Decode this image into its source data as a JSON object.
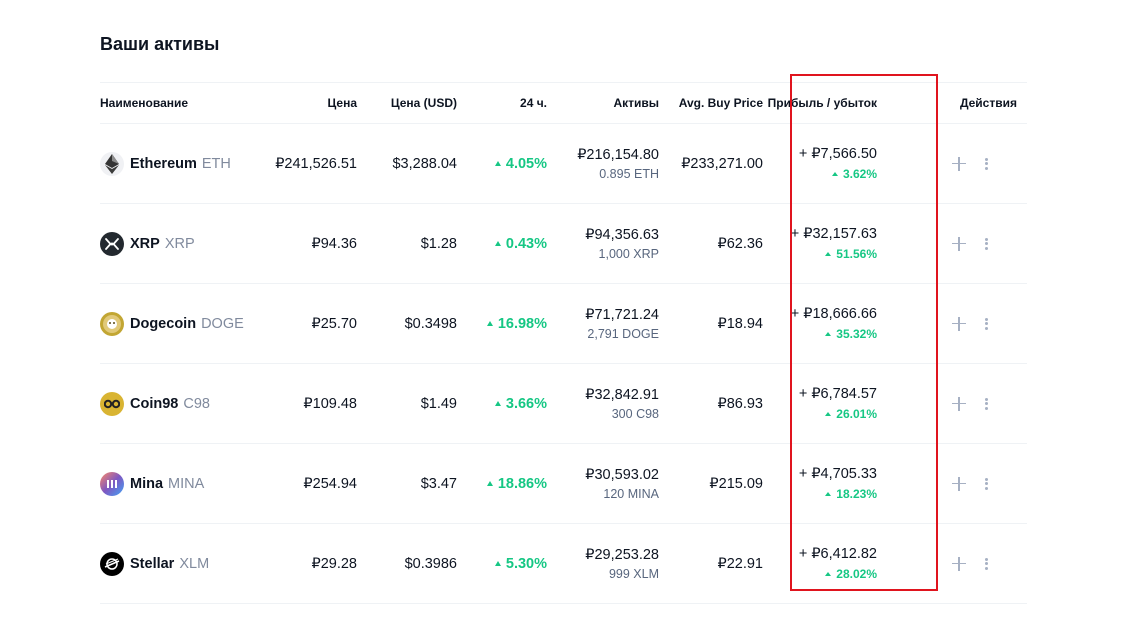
{
  "title": "Ваши активы",
  "headers": {
    "name": "Наименование",
    "price": "Цена",
    "price_usd": "Цена (USD)",
    "change_24h": "24 ч.",
    "holdings": "Активы",
    "avg_buy": "Avg. Buy Price",
    "profit_loss": "Прибыль / убыток",
    "actions": "Действия"
  },
  "colors": {
    "positive": "#16c784",
    "highlight_box": "#e0141e",
    "muted": "#808a9d"
  },
  "assets": [
    {
      "name": "Ethereum",
      "symbol": "ETH",
      "icon": "ethereum-icon",
      "price": "₽241,526.51",
      "price_usd": "$3,288.04",
      "change_24h": "4.05%",
      "holdings_value": "₽216,154.80",
      "holdings_amount": "0.895 ETH",
      "avg_buy": "₽233,271.00",
      "pl_value": "+ ₽7,566.50",
      "pl_pct": "3.62%"
    },
    {
      "name": "XRP",
      "symbol": "XRP",
      "icon": "xrp-icon",
      "price": "₽94.36",
      "price_usd": "$1.28",
      "change_24h": "0.43%",
      "holdings_value": "₽94,356.63",
      "holdings_amount": "1,000 XRP",
      "avg_buy": "₽62.36",
      "pl_value": "+ ₽32,157.63",
      "pl_pct": "51.56%"
    },
    {
      "name": "Dogecoin",
      "symbol": "DOGE",
      "icon": "dogecoin-icon",
      "price": "₽25.70",
      "price_usd": "$0.3498",
      "change_24h": "16.98%",
      "holdings_value": "₽71,721.24",
      "holdings_amount": "2,791 DOGE",
      "avg_buy": "₽18.94",
      "pl_value": "+ ₽18,666.66",
      "pl_pct": "35.32%"
    },
    {
      "name": "Coin98",
      "symbol": "C98",
      "icon": "coin98-icon",
      "price": "₽109.48",
      "price_usd": "$1.49",
      "change_24h": "3.66%",
      "holdings_value": "₽32,842.91",
      "holdings_amount": "300 C98",
      "avg_buy": "₽86.93",
      "pl_value": "+ ₽6,784.57",
      "pl_pct": "26.01%"
    },
    {
      "name": "Mina",
      "symbol": "MINA",
      "icon": "mina-icon",
      "price": "₽254.94",
      "price_usd": "$3.47",
      "change_24h": "18.86%",
      "holdings_value": "₽30,593.02",
      "holdings_amount": "120 MINA",
      "avg_buy": "₽215.09",
      "pl_value": "+ ₽4,705.33",
      "pl_pct": "18.23%"
    },
    {
      "name": "Stellar",
      "symbol": "XLM",
      "icon": "stellar-icon",
      "price": "₽29.28",
      "price_usd": "$0.3986",
      "change_24h": "5.30%",
      "holdings_value": "₽29,253.28",
      "holdings_amount": "999 XLM",
      "avg_buy": "₽22.91",
      "pl_value": "+ ₽6,412.82",
      "pl_pct": "28.02%"
    }
  ]
}
